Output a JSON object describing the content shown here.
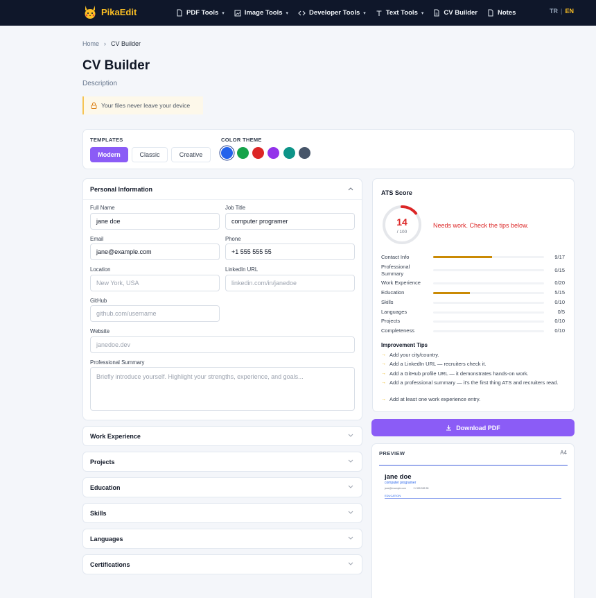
{
  "nav": {
    "brand": "PikaEdit",
    "items": [
      {
        "label": "PDF Tools",
        "icon": "file-icon",
        "caret": true
      },
      {
        "label": "Image Tools",
        "icon": "image-icon",
        "caret": true
      },
      {
        "label": "Developer Tools",
        "icon": "code-icon",
        "caret": true
      },
      {
        "label": "Text Tools",
        "icon": "text-icon",
        "caret": true
      },
      {
        "label": "CV Builder",
        "icon": "document-icon",
        "caret": false
      },
      {
        "label": "Notes",
        "icon": "note-icon",
        "caret": false
      }
    ],
    "lang_tr": "TR",
    "lang_sep": "|",
    "lang_en": "EN"
  },
  "breadcrumb": {
    "home": "Home",
    "sep": "›",
    "current": "CV Builder"
  },
  "page": {
    "title": "CV Builder",
    "description": "Description",
    "notice": "Your files never leave your device"
  },
  "templates": {
    "heading": "TEMPLATES",
    "options": [
      "Modern",
      "Classic",
      "Creative"
    ],
    "selected": "Modern",
    "color_heading": "COLOR THEME",
    "colors": [
      "#2563eb",
      "#16a34a",
      "#dc2626",
      "#9333ea",
      "#0d9488",
      "#475569"
    ]
  },
  "personal": {
    "title": "Personal Information",
    "full_name_label": "Full Name",
    "full_name": "jane doe",
    "job_title_label": "Job Title",
    "job_title": "computer programer",
    "email_label": "Email",
    "email": "jane@example.com",
    "phone_label": "Phone",
    "phone": "+1 555 555 55",
    "location_label": "Location",
    "location_placeholder": "New York, USA",
    "linkedin_label": "LinkedIn URL",
    "linkedin_placeholder": "linkedin.com/in/janedoe",
    "github_label": "GitHub",
    "github_placeholder": "github.com/username",
    "website_label": "Website",
    "website_placeholder": "janedoe.dev",
    "summary_label": "Professional Summary",
    "summary_placeholder": "Briefly introduce yourself. Highlight your strengths, experience, and goals..."
  },
  "sections": [
    "Work Experience",
    "Projects",
    "Education",
    "Skills",
    "Languages",
    "Certifications"
  ],
  "ats": {
    "title": "ATS Score",
    "score": "14",
    "max": "/ 100",
    "score_value": 14,
    "status": "Needs work. Check the tips below.",
    "criteria": [
      {
        "label": "Contact Info",
        "value": "9/17",
        "fraction": 0.53
      },
      {
        "label": "Professional Summary",
        "value": "0/15",
        "fraction": 0
      },
      {
        "label": "Work Experience",
        "value": "0/20",
        "fraction": 0
      },
      {
        "label": "Education",
        "value": "5/15",
        "fraction": 0.33
      },
      {
        "label": "Skills",
        "value": "0/10",
        "fraction": 0
      },
      {
        "label": "Languages",
        "value": "0/5",
        "fraction": 0
      },
      {
        "label": "Projects",
        "value": "0/10",
        "fraction": 0
      },
      {
        "label": "Completeness",
        "value": "0/10",
        "fraction": 0
      }
    ],
    "tips_title": "Improvement Tips",
    "tips": [
      "Add your city/country.",
      "Add a LinkedIn URL — recruiters check it.",
      "Add a GitHub profile URL — it demonstrates hands-on work.",
      "Add a professional summary — it's the first thing ATS and recruiters read.",
      "Add at least one work experience entry."
    ]
  },
  "download_label": "Download PDF",
  "preview": {
    "heading": "PREVIEW",
    "size": "A4",
    "name": "jane doe",
    "job": "computer programer",
    "email": "jane@example.com",
    "phone": "+1 555 555 55",
    "section": "EDUCATION"
  }
}
